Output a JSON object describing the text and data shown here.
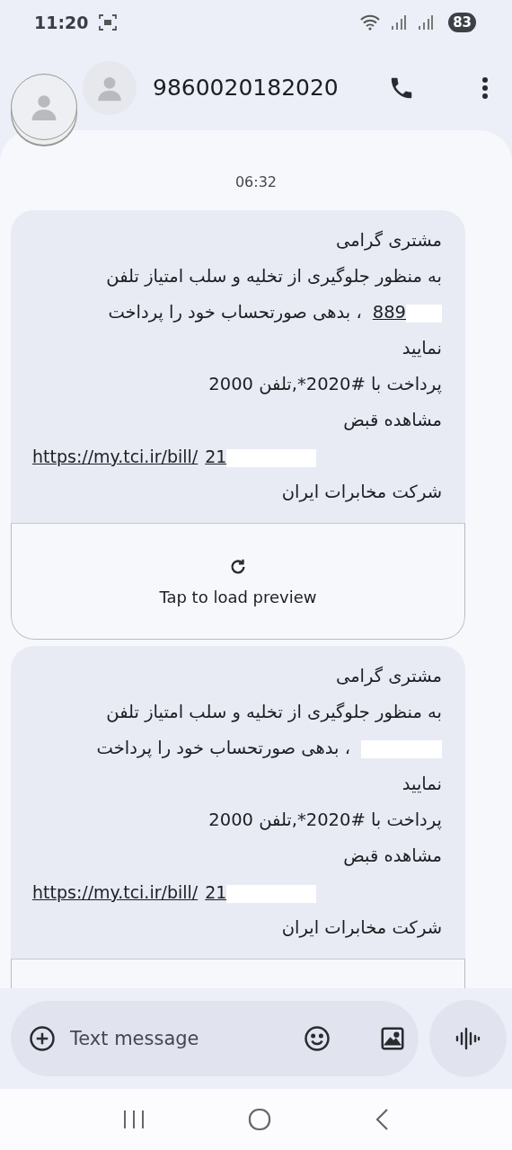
{
  "status_bar": {
    "time": "11:20",
    "battery": "83"
  },
  "header": {
    "title": "9860020182020"
  },
  "timestamp": "06:32",
  "messages": [
    {
      "lines": [
        {
          "kind": "text",
          "text": "مشتری گرامی"
        },
        {
          "kind": "text",
          "text": "به منظور جلوگیری از تخلیه و سلب امتیاز تلفن"
        },
        {
          "kind": "phone",
          "number": "889",
          "text": "، بدهی صورتحساب خود را پرداخت"
        },
        {
          "kind": "text",
          "text": "نمایید"
        },
        {
          "kind": "text",
          "text": "پرداخت با #2020*,تلفن 2000"
        },
        {
          "kind": "text",
          "text": "مشاهده قبض"
        },
        {
          "kind": "link",
          "url": "https://my.tci.ir/bill/",
          "code": "21"
        },
        {
          "kind": "text",
          "text": "شرکت مخابرات ایران"
        }
      ],
      "preview": {
        "kind": "prompt",
        "label": "Tap to load preview"
      }
    },
    {
      "lines": [
        {
          "kind": "text",
          "text": "مشتری گرامی"
        },
        {
          "kind": "text",
          "text": "به منظور جلوگیری از تخلیه و سلب امتیاز تلفن"
        },
        {
          "kind": "phone",
          "text": "، بدهی صورتحساب خود را پرداخت"
        },
        {
          "kind": "text",
          "text": "نمایید"
        },
        {
          "kind": "text",
          "text": "پرداخت با #2020*,تلفن 2000"
        },
        {
          "kind": "text",
          "text": "مشاهده قبض"
        },
        {
          "kind": "link",
          "url": "https://my.tci.ir/bill/",
          "code": "21"
        },
        {
          "kind": "text",
          "text": "شرکت مخابرات ایران"
        }
      ],
      "preview": {
        "kind": "cut_off"
      }
    }
  ],
  "composer": {
    "placeholder": "Text message"
  }
}
